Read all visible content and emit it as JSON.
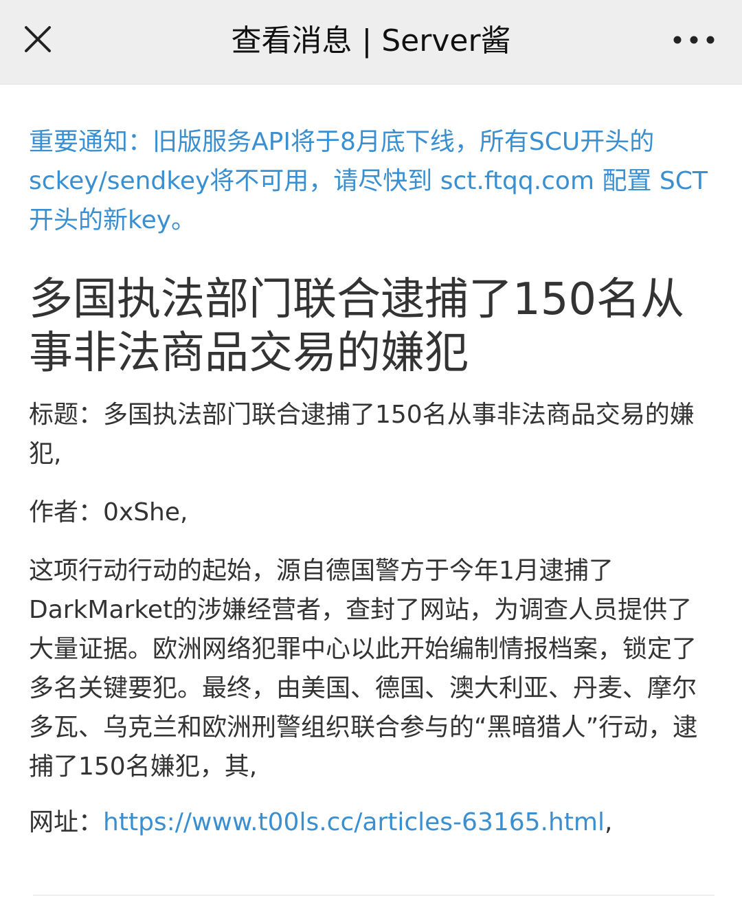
{
  "header": {
    "title": "查看消息 | Server酱",
    "close_icon": "close-icon",
    "more_icon": "more-dots-icon"
  },
  "notice": {
    "text": "重要通知：旧版服务API将于8月底下线，所有SCU开头的sckey/sendkey将不可用，请尽快到 sct.ftqq.com 配置 SCT 开头的新key。",
    "color": "#3a8fd0"
  },
  "article": {
    "headline": "多国执法部门联合逮捕了150名从事非法商品交易的嫌犯",
    "title_line": "标题：多国执法部门联合逮捕了150名从事非法商品交易的嫌犯,",
    "author_line": "作者：0xShe,",
    "body": "这项行动行动的起始，源自德国警方于今年1月逮捕了DarkMarket的涉嫌经营者，查封了网站，为调查人员提供了大量证据。欧洲网络犯罪中心以此开始编制情报档案，锁定了多名关键要犯。最终，由美国、德国、澳大利亚、丹麦、摩尔多瓦、乌克兰和欧洲刑警组织联合参与的“黑暗猎人”行动，逮捕了150名嫌犯，其,",
    "url_label": "网址：",
    "url": "https://www.t00ls.cc/articles-63165.html",
    "url_suffix": ","
  }
}
